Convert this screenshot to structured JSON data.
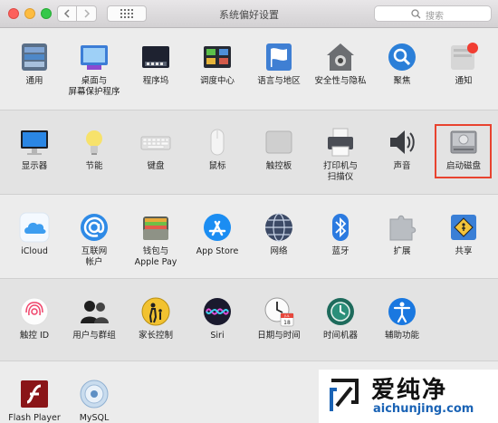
{
  "window": {
    "title": "系统偏好设置"
  },
  "search": {
    "placeholder": "搜索"
  },
  "rows": [
    {
      "items": [
        {
          "id": "general",
          "label": "通用"
        },
        {
          "id": "desktop",
          "label": "桌面与\n屏幕保护程序"
        },
        {
          "id": "dock",
          "label": "程序坞"
        },
        {
          "id": "mission",
          "label": "调度中心"
        },
        {
          "id": "language",
          "label": "语言与地区"
        },
        {
          "id": "security",
          "label": "安全性与隐私"
        },
        {
          "id": "spotlight",
          "label": "聚焦"
        },
        {
          "id": "notifications",
          "label": "通知"
        }
      ]
    },
    {
      "items": [
        {
          "id": "displays",
          "label": "显示器"
        },
        {
          "id": "energy",
          "label": "节能"
        },
        {
          "id": "keyboard",
          "label": "键盘"
        },
        {
          "id": "mouse",
          "label": "鼠标"
        },
        {
          "id": "trackpad",
          "label": "触控板"
        },
        {
          "id": "printers",
          "label": "打印机与\n扫描仪"
        },
        {
          "id": "sound",
          "label": "声音"
        },
        {
          "id": "startup",
          "label": "启动磁盘"
        }
      ]
    },
    {
      "items": [
        {
          "id": "icloud",
          "label": "iCloud"
        },
        {
          "id": "internet",
          "label": "互联网\n帐户"
        },
        {
          "id": "wallet",
          "label": "钱包与\nApple Pay"
        },
        {
          "id": "appstore",
          "label": "App Store"
        },
        {
          "id": "network",
          "label": "网络"
        },
        {
          "id": "bluetooth",
          "label": "蓝牙"
        },
        {
          "id": "extensions",
          "label": "扩展"
        },
        {
          "id": "sharing",
          "label": "共享"
        }
      ]
    },
    {
      "items": [
        {
          "id": "touchid",
          "label": "触控 ID"
        },
        {
          "id": "users",
          "label": "用户与群组"
        },
        {
          "id": "parental",
          "label": "家长控制"
        },
        {
          "id": "siri",
          "label": "Siri"
        },
        {
          "id": "datetime",
          "label": "日期与时间"
        },
        {
          "id": "timemachine",
          "label": "时间机器"
        },
        {
          "id": "accessibility",
          "label": "辅助功能"
        }
      ]
    },
    {
      "items": [
        {
          "id": "flash",
          "label": "Flash Player"
        },
        {
          "id": "mysql",
          "label": "MySQL"
        }
      ]
    }
  ],
  "calendar_icon": {
    "month": "JUL",
    "day": "18"
  },
  "watermark": {
    "brand": "爱纯净",
    "url": "aichunjing.com"
  },
  "highlighted_item": "startup"
}
